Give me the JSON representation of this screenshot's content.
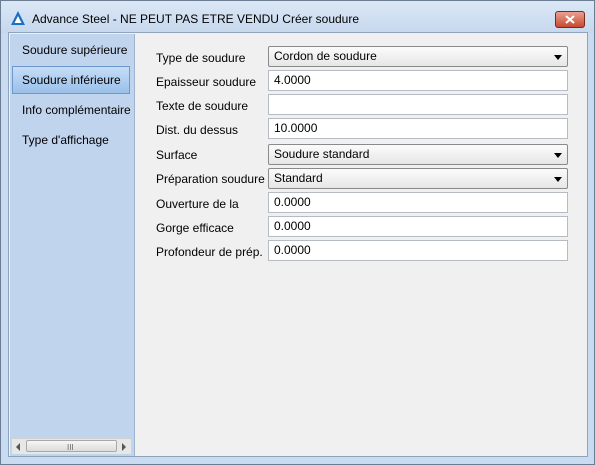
{
  "window": {
    "title": "Advance Steel - NE PEUT PAS ETRE VENDU   Créer soudure"
  },
  "sidebar": {
    "items": [
      {
        "label": "Soudure supérieure",
        "selected": false
      },
      {
        "label": "Soudure inférieure",
        "selected": true
      },
      {
        "label": "Info complémentaire",
        "selected": false
      },
      {
        "label": "Type d'affichage",
        "selected": false
      }
    ],
    "scrollbar_grip": "III"
  },
  "form": {
    "fields": [
      {
        "label": "Type de soudure",
        "type": "dropdown",
        "value": "Cordon de soudure"
      },
      {
        "label": "Epaisseur soudure",
        "type": "text",
        "value": "4.0000"
      },
      {
        "label": "Texte de soudure",
        "type": "text",
        "value": ""
      },
      {
        "label": "Dist. du dessus",
        "type": "text",
        "value": "10.0000"
      },
      {
        "label": "Surface",
        "type": "dropdown",
        "value": "Soudure standard"
      },
      {
        "label": "Préparation soudure",
        "type": "dropdown",
        "value": "Standard"
      },
      {
        "label": "Ouverture de la",
        "type": "text",
        "value": "0.0000"
      },
      {
        "label": "Gorge efficace",
        "type": "text",
        "value": "0.0000"
      },
      {
        "label": "Profondeur de prép.",
        "type": "text",
        "value": "0.0000"
      }
    ]
  },
  "icons": {
    "app": "advance-steel-logo-icon",
    "close": "close-icon",
    "dropdown": "chevron-down-icon"
  },
  "colors": {
    "selected_item": "#9ac0ea",
    "sidebar_bg": "#c1d4ee",
    "close_button": "#c84a30"
  }
}
